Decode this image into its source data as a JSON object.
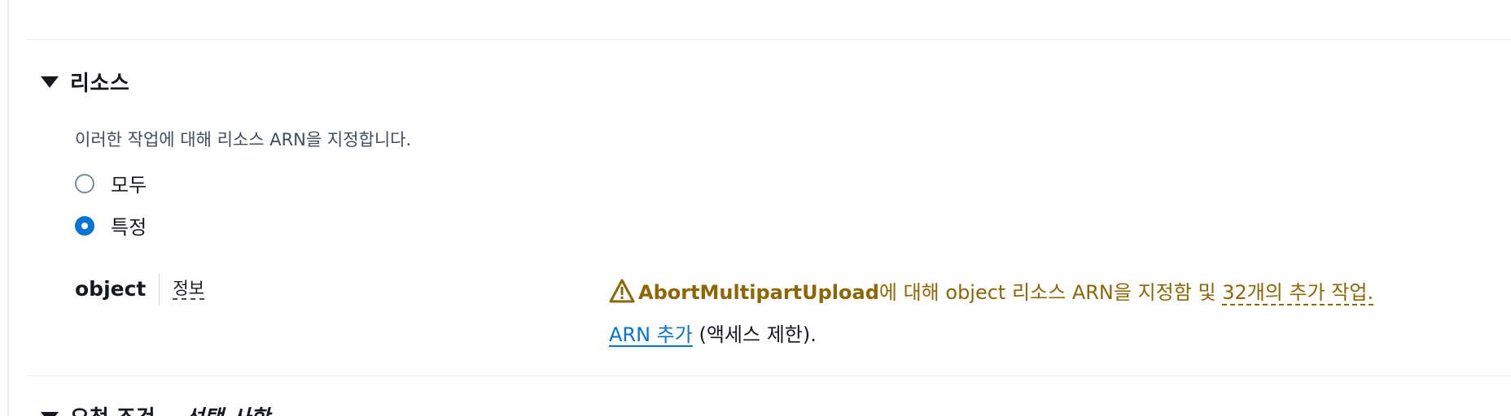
{
  "section": {
    "title": "리소스",
    "description": "이러한 작업에 대해 리소스 ARN을 지정합니다."
  },
  "radios": [
    {
      "label": "모두",
      "checked": false
    },
    {
      "label": "특정",
      "checked": true
    }
  ],
  "object": {
    "name": "object",
    "info_label": "정보"
  },
  "warning": {
    "action_name": "AbortMultipartUpload",
    "middle_text": "에 대해 object 리소스 ARN을 지정함 및 ",
    "more_link": "32개의 추가 작업.",
    "add_arn_link": "ARN 추가",
    "add_arn_suffix": " (액세스 제한).",
    "icon": "warning-triangle-icon",
    "color": "#8d6605"
  },
  "next_section": {
    "title": "요청 조건",
    "optional": "- 선택 사항"
  },
  "colors": {
    "accent": "#0972d3",
    "warning": "#8d6605",
    "text": "#16191f"
  }
}
